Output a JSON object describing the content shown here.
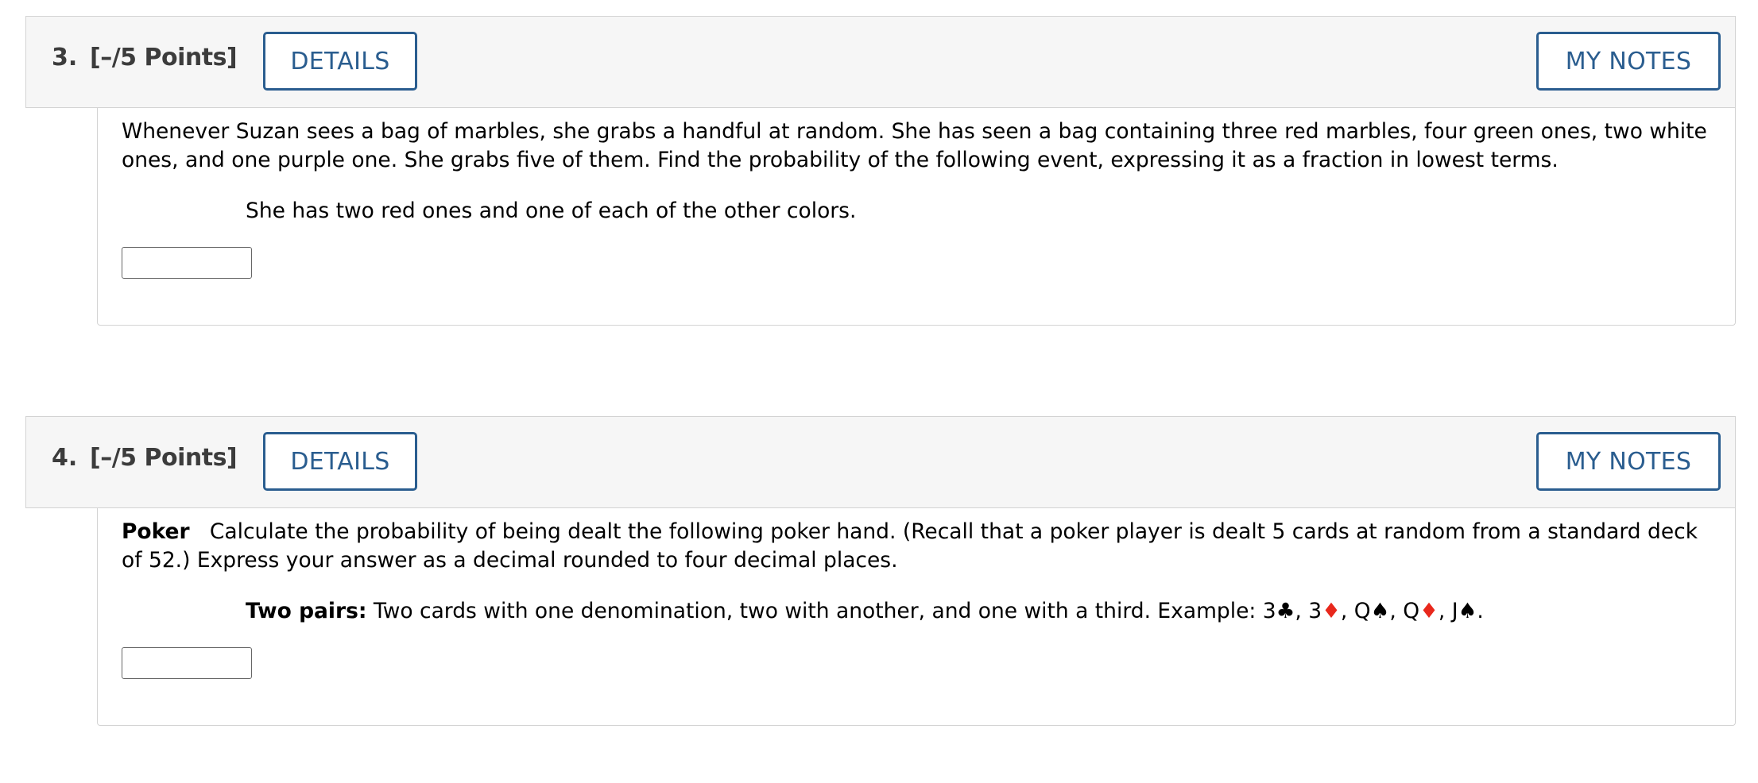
{
  "questions": [
    {
      "number": "3.",
      "points": "[–/5 Points]",
      "details_label": "DETAILS",
      "notes_label": "MY NOTES",
      "prompt": "Whenever Suzan sees a bag of marbles, she grabs a handful at random. She has seen a bag containing three red marbles, four green ones, two white ones, and one purple one. She grabs five of them. Find the probability of the following event, expressing it as a fraction in lowest terms.",
      "sub_prompt": "She has two red ones and one of each of the other colors.",
      "answer_value": ""
    },
    {
      "number": "4.",
      "points": "[–/5 Points]",
      "details_label": "DETAILS",
      "notes_label": "MY NOTES",
      "prompt_title": "Poker",
      "prompt": "Calculate the probability of being dealt the following poker hand. (Recall that a poker player is dealt 5 cards at random from a standard deck of 52.) Express your answer as a decimal rounded to four decimal places.",
      "sub_prompt_title": "Two pairs:",
      "sub_prompt": "Two cards with one denomination, two with another, and one with a third. Example:",
      "example_cards": [
        {
          "rank": "3",
          "suit": "♣",
          "color": "black",
          "sep": ", "
        },
        {
          "rank": "3",
          "suit": "♦",
          "color": "red",
          "sep": ", "
        },
        {
          "rank": "Q",
          "suit": "♠",
          "color": "black",
          "sep": ", "
        },
        {
          "rank": "Q",
          "suit": "♦",
          "color": "red",
          "sep": ", "
        },
        {
          "rank": "J",
          "suit": "♠",
          "color": "black",
          "sep": "."
        }
      ],
      "answer_value": ""
    }
  ],
  "colors": {
    "accent": "#2a5d8f",
    "header_bg": "#f6f6f6",
    "border": "#d3d3d3",
    "suit_red": "#e8281c"
  }
}
